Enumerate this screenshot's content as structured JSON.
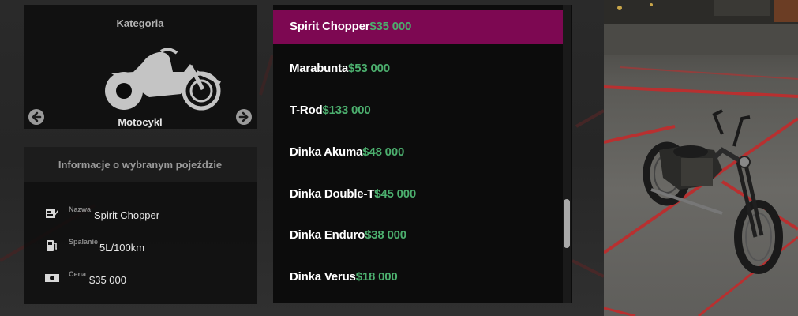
{
  "category": {
    "title": "Kategoria",
    "value": "Motocykl",
    "icon": "motorcycle-icon",
    "prev_icon": "arrow-left-icon",
    "next_icon": "arrow-right-icon"
  },
  "info": {
    "title": "Informacje o wybranym pojeździe",
    "rows": [
      {
        "icon": "id-card-icon",
        "label": "Nazwa",
        "value": "Spirit Chopper"
      },
      {
        "icon": "fuel-pump-icon",
        "label": "Spalanie",
        "value": "5L/100km"
      },
      {
        "icon": "banknote-icon",
        "label": "Cena",
        "value": "$35 000"
      }
    ]
  },
  "vehicles": [
    {
      "name": "Spirit Chopper",
      "price": "$35 000",
      "selected": true
    },
    {
      "name": "Marabunta",
      "price": "$53 000",
      "selected": false
    },
    {
      "name": "T-Rod",
      "price": "$133 000",
      "selected": false
    },
    {
      "name": "Dinka Akuma",
      "price": "$48 000",
      "selected": false
    },
    {
      "name": "Dinka Double-T",
      "price": "$45 000",
      "selected": false
    },
    {
      "name": "Dinka Enduro",
      "price": "$38 000",
      "selected": false
    },
    {
      "name": "Dinka Verus",
      "price": "$18 000",
      "selected": false
    }
  ],
  "colors": {
    "selected": "#7d0852",
    "price": "#4caf6e",
    "floor_line": "#b83030"
  }
}
